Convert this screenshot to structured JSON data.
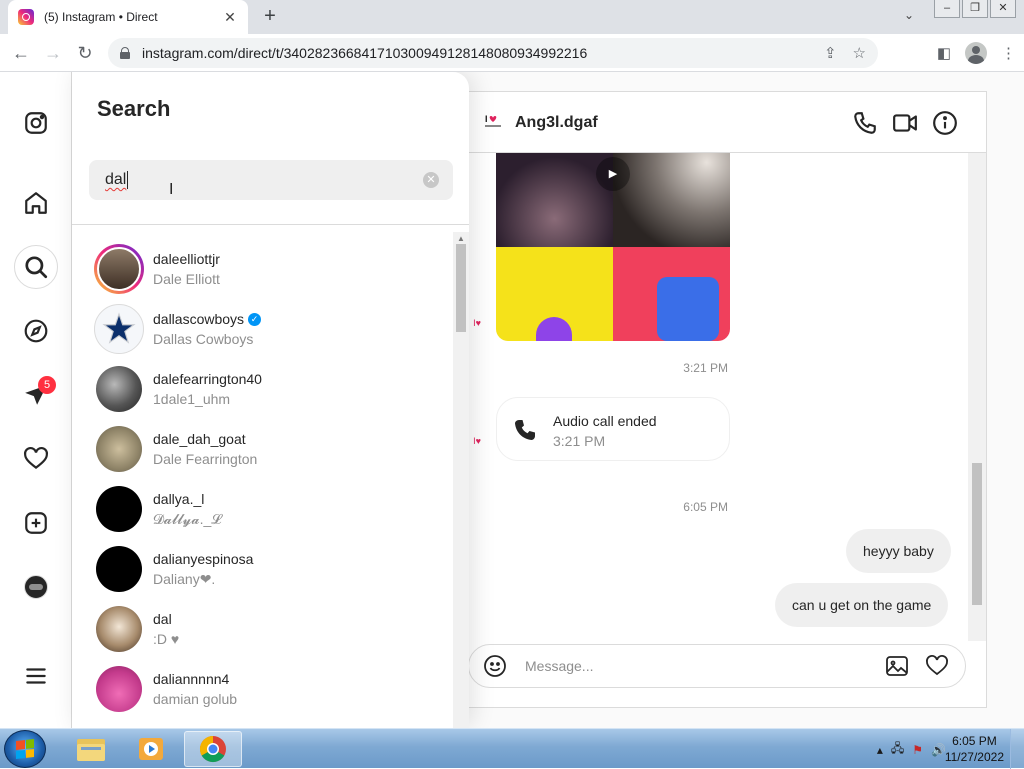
{
  "browser": {
    "tab_title": "(5) Instagram • Direct",
    "url": "instagram.com/direct/t/340282366841710300949128148080934992216",
    "new_tab_label": "+",
    "close_tab_label": "✕"
  },
  "nav_rail": {
    "messages_badge": "5"
  },
  "search": {
    "title": "Search",
    "query": "dal",
    "results": [
      {
        "username": "daleelliottjr",
        "full_name": "Dale Elliott",
        "verified": false
      },
      {
        "username": "dallascowboys",
        "full_name": "Dallas Cowboys",
        "verified": true
      },
      {
        "username": "dalefearrington40",
        "full_name": "1dale1_uhm",
        "verified": false
      },
      {
        "username": "dale_dah_goat",
        "full_name": "Dale Fearrington",
        "verified": false
      },
      {
        "username": "dallya._l",
        "full_name": "𝓓𝓪𝓵𝓵𝔂𝓪._𝓛",
        "verified": false
      },
      {
        "username": "dalianyespinosa",
        "full_name": "Daliany❤.",
        "verified": false
      },
      {
        "username": "dal",
        "full_name": ":D ♥",
        "verified": false
      },
      {
        "username": "daliannnnn4",
        "full_name": "damian golub",
        "verified": false
      }
    ]
  },
  "conversation": {
    "name": "Ang3l.dgaf",
    "timestamp_1": "3:21 PM",
    "call_title": "Audio call ended",
    "call_time": "3:21 PM",
    "timestamp_2": "6:05 PM",
    "outgoing": [
      "heyyy baby",
      "can u get on the game"
    ],
    "composer_placeholder": "Message..."
  },
  "taskbar": {
    "time": "6:05 PM",
    "date": "11/27/2022"
  },
  "colors": {
    "badge": "#ff3040",
    "verified": "#0095f6",
    "accent_gradient": [
      "#f9ce34",
      "#ee2a7b",
      "#6228d7"
    ]
  }
}
